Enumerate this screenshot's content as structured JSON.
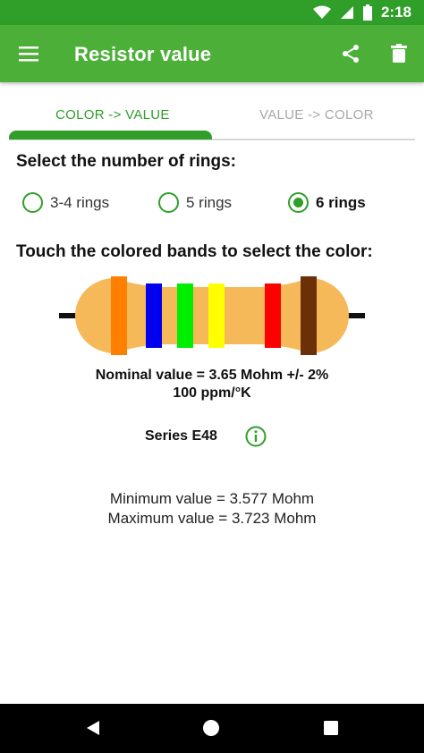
{
  "status": {
    "time": "2:18"
  },
  "app_bar": {
    "title": "Resistor value"
  },
  "tabs": [
    {
      "label": "COLOR -> VALUE",
      "active": true
    },
    {
      "label": "VALUE -> COLOR",
      "active": false
    }
  ],
  "rings": {
    "title": "Select the number of rings:",
    "options": [
      {
        "label": "3-4 rings",
        "checked": false
      },
      {
        "label": "5 rings",
        "checked": false
      },
      {
        "label": "6 rings",
        "checked": true
      }
    ]
  },
  "bands": {
    "title": "Touch the colored bands to select the color:",
    "colors": [
      "#ff8000",
      "#0000ee",
      "#00ee00",
      "#ffff00",
      "#ff0000",
      "#6b3008"
    ],
    "body_color": "#f5b95a"
  },
  "result": {
    "nominal": "Nominal value = 3.65 Mohm   +/- 2%",
    "tempco": "100 ppm/°K",
    "series": "Series E48",
    "minimum": "Minimum value = 3.577 Mohm",
    "maximum": "Maximum value = 3.723 Mohm"
  },
  "theme": {
    "primary": "#4caf38",
    "primary_dark": "#2f9f2a"
  }
}
